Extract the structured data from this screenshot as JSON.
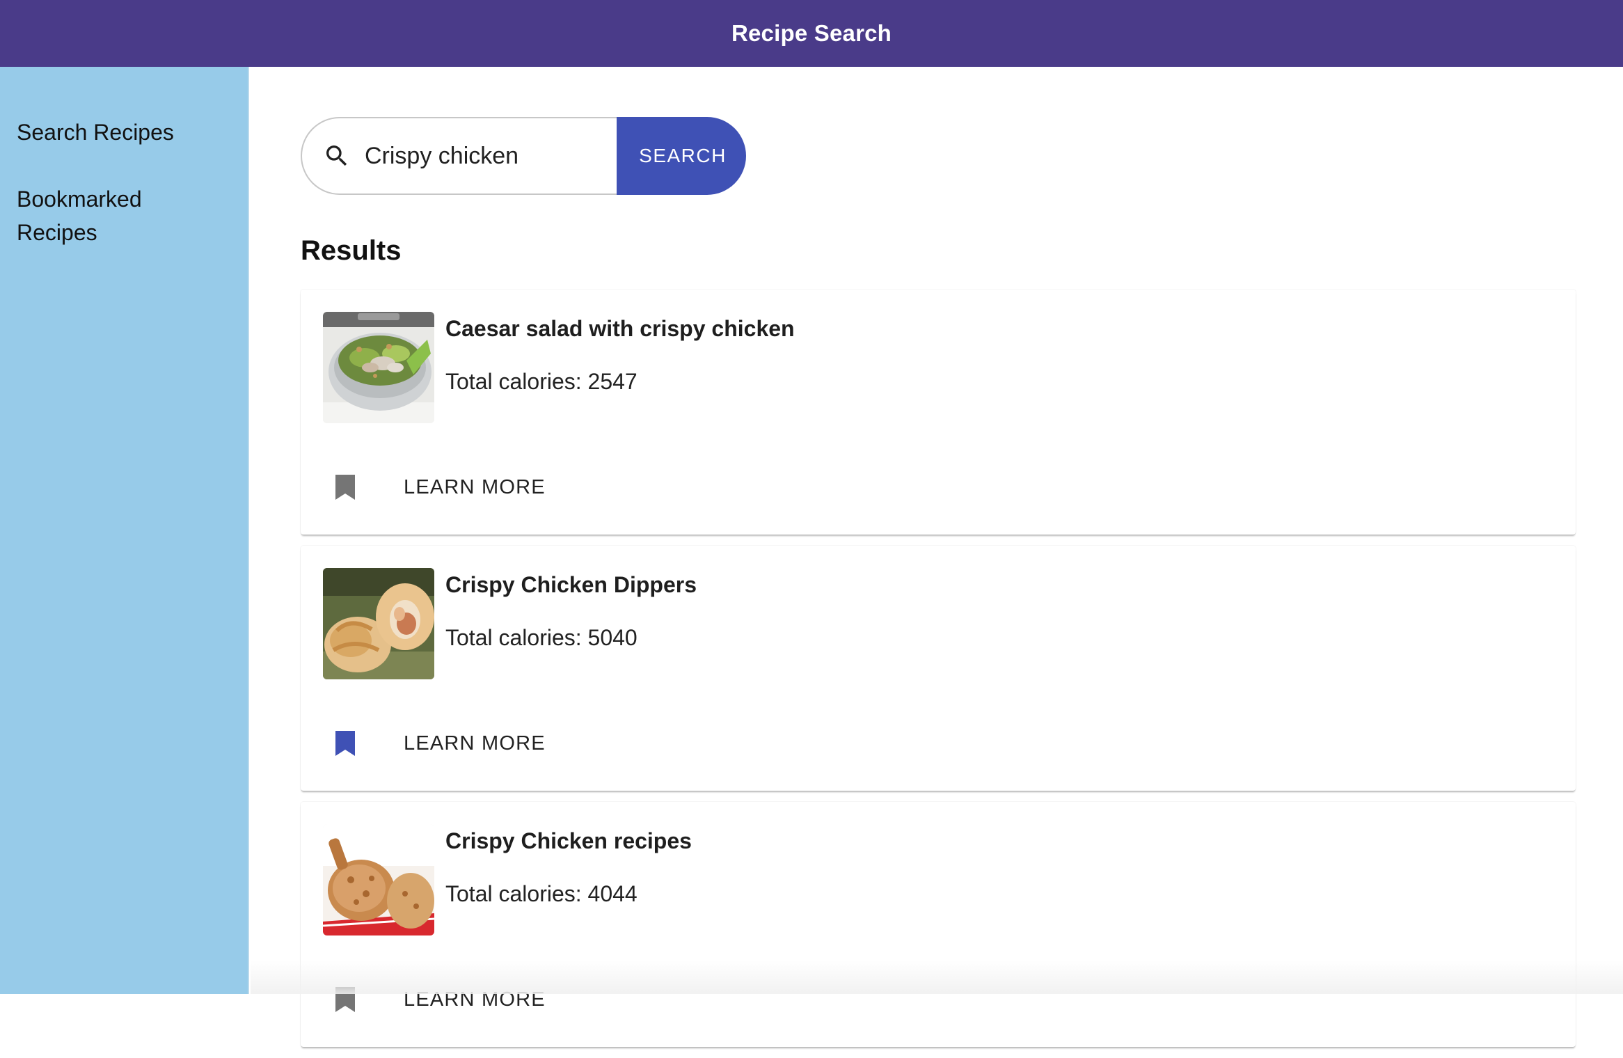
{
  "header": {
    "title": "Recipe Search"
  },
  "colors": {
    "primary": "#4a3b89",
    "sidebar_bg": "#97cbe9",
    "accent": "#3f51b5",
    "bookmark_inactive": "#757575",
    "bookmark_active": "#3f51b5"
  },
  "sidebar": {
    "items": [
      {
        "label": "Search Recipes"
      },
      {
        "label": "Bookmarked Recipes"
      }
    ]
  },
  "search": {
    "icon": "search-icon",
    "value": "Crispy chicken",
    "button_label": "SEARCH"
  },
  "results": {
    "heading": "Results",
    "items": [
      {
        "title": "Caesar salad with crispy chicken",
        "calories": "Total calories: 2547",
        "bookmarked": false,
        "action_label": "LEARN MORE",
        "image": "caesar-salad-image"
      },
      {
        "title": "Crispy Chicken Dippers",
        "calories": "Total calories: 5040",
        "bookmarked": true,
        "action_label": "LEARN MORE",
        "image": "chicken-dippers-image"
      },
      {
        "title": "Crispy Chicken recipes",
        "calories": "Total calories: 4044",
        "bookmarked": false,
        "action_label": "LEARN MORE",
        "image": "fried-chicken-image"
      }
    ]
  }
}
